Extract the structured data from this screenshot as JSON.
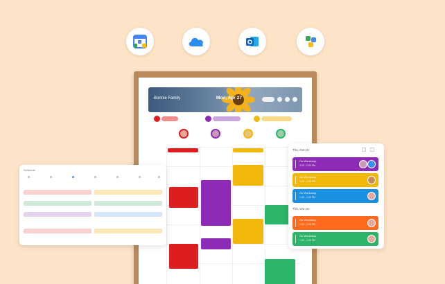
{
  "integrations": [
    {
      "name": "google-calendar-icon"
    },
    {
      "name": "icloud-icon"
    },
    {
      "name": "outlook-icon"
    },
    {
      "name": "family-sharing-icon"
    }
  ],
  "colors": {
    "background": "#fde4c8",
    "frame": "#b98a5c",
    "red": "#dd1e1e",
    "purple": "#8e2ab8",
    "yellow": "#f2b90c",
    "green": "#2bb46a",
    "orange": "#ff6a1e",
    "blue": "#1b8fe0"
  },
  "calendar": {
    "banner_title": "Bonnie Family",
    "banner_date": "Mon, Apr 27"
  },
  "events_panel": {
    "days": [
      {
        "heading": "Thu, Oct 19",
        "events": [
          {
            "title": "Go Workshop",
            "time": "1:00 - 2:00 PM",
            "color": "#8e2ab8"
          },
          {
            "title": "Go Workshop",
            "time": "1:00 - 2:00 PM",
            "color": "#f2b90c"
          },
          {
            "title": "Go Workshop",
            "time": "1:00 - 2:00 PM",
            "color": "#1b8fe0"
          }
        ]
      },
      {
        "heading": "Thu, Oct 19",
        "events": [
          {
            "title": "Go Workshop",
            "time": "1:00 - 2:00 PM",
            "color": "#ff6a1e"
          },
          {
            "title": "Go Workshop",
            "time": "1:00 - 2:00 PM",
            "color": "#2bb46a"
          }
        ]
      }
    ]
  },
  "tasks_panel": {
    "heading": "Schedule"
  }
}
